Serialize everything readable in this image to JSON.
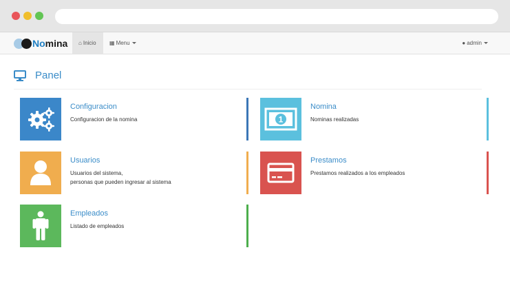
{
  "brand": {
    "name_highlight": "No",
    "name_rest": "mina"
  },
  "navbar": {
    "inicio_label": "Inicio",
    "menu_label": "Menu",
    "user_label": "admin"
  },
  "panel": {
    "title": "Panel"
  },
  "tiles": [
    {
      "title": "Configuracion",
      "desc": [
        "Configuracion de la nomina"
      ],
      "color": "#3b87c9",
      "bar_color": "#3b76b6",
      "icon": "gears-icon"
    },
    {
      "title": "Nomina",
      "desc": [
        "Nominas realizadas"
      ],
      "color": "#5bc0de",
      "bar_color": "#5bc0de",
      "icon": "money-icon"
    },
    {
      "title": "Usuarios",
      "desc": [
        "Usuarios del sistema,",
        "personas que pueden ingresar al sistema"
      ],
      "color": "#f0ad4e",
      "bar_color": "#f0ad4e",
      "icon": "user-icon"
    },
    {
      "title": "Prestamos",
      "desc": [
        "Prestamos realizados a los empleados"
      ],
      "color": "#d9534f",
      "bar_color": "#d9534f",
      "icon": "credit-card-icon"
    },
    {
      "title": "Empleados",
      "desc": [
        "Listado de empleados"
      ],
      "color": "#5cb85c",
      "bar_color": "#4cae4c",
      "icon": "person-icon"
    }
  ]
}
